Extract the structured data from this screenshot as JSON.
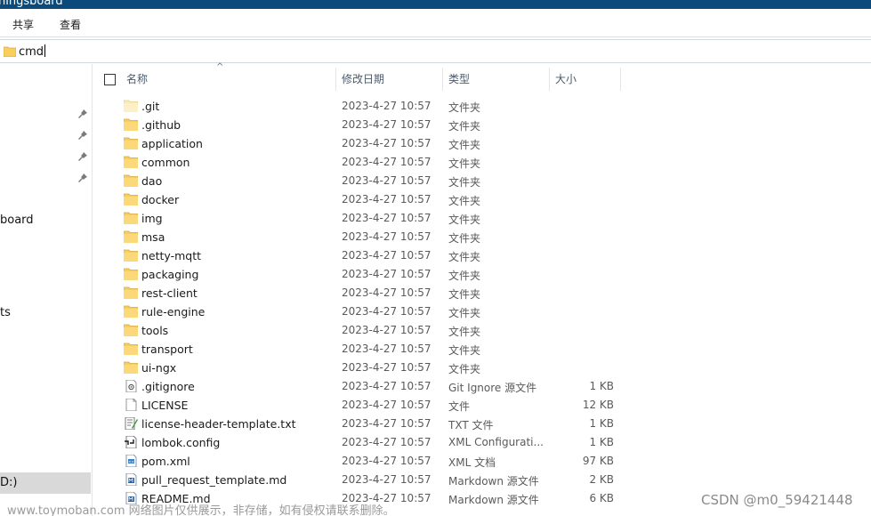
{
  "window": {
    "title": "hingsboard"
  },
  "ribbon": {
    "tabs": [
      "共享",
      "查看"
    ]
  },
  "address": {
    "value": "cmd"
  },
  "nav": {
    "items": [
      "board",
      "ts"
    ],
    "selected": "D:)"
  },
  "columns": {
    "name": "名称",
    "date": "修改日期",
    "type": "类型",
    "size": "大小"
  },
  "files": [
    {
      "name": ".git",
      "date": "2023-4-27 10:57",
      "type": "文件夹",
      "size": "",
      "icon": "folder-light-icon"
    },
    {
      "name": ".github",
      "date": "2023-4-27 10:57",
      "type": "文件夹",
      "size": "",
      "icon": "folder-icon"
    },
    {
      "name": "application",
      "date": "2023-4-27 10:57",
      "type": "文件夹",
      "size": "",
      "icon": "folder-icon"
    },
    {
      "name": "common",
      "date": "2023-4-27 10:57",
      "type": "文件夹",
      "size": "",
      "icon": "folder-icon"
    },
    {
      "name": "dao",
      "date": "2023-4-27 10:57",
      "type": "文件夹",
      "size": "",
      "icon": "folder-icon"
    },
    {
      "name": "docker",
      "date": "2023-4-27 10:57",
      "type": "文件夹",
      "size": "",
      "icon": "folder-icon"
    },
    {
      "name": "img",
      "date": "2023-4-27 10:57",
      "type": "文件夹",
      "size": "",
      "icon": "folder-icon"
    },
    {
      "name": "msa",
      "date": "2023-4-27 10:57",
      "type": "文件夹",
      "size": "",
      "icon": "folder-icon"
    },
    {
      "name": "netty-mqtt",
      "date": "2023-4-27 10:57",
      "type": "文件夹",
      "size": "",
      "icon": "folder-icon"
    },
    {
      "name": "packaging",
      "date": "2023-4-27 10:57",
      "type": "文件夹",
      "size": "",
      "icon": "folder-icon"
    },
    {
      "name": "rest-client",
      "date": "2023-4-27 10:57",
      "type": "文件夹",
      "size": "",
      "icon": "folder-icon"
    },
    {
      "name": "rule-engine",
      "date": "2023-4-27 10:57",
      "type": "文件夹",
      "size": "",
      "icon": "folder-icon"
    },
    {
      "name": "tools",
      "date": "2023-4-27 10:57",
      "type": "文件夹",
      "size": "",
      "icon": "folder-icon"
    },
    {
      "name": "transport",
      "date": "2023-4-27 10:57",
      "type": "文件夹",
      "size": "",
      "icon": "folder-icon"
    },
    {
      "name": "ui-ngx",
      "date": "2023-4-27 10:57",
      "type": "文件夹",
      "size": "",
      "icon": "folder-icon"
    },
    {
      "name": ".gitignore",
      "date": "2023-4-27 10:57",
      "type": "Git Ignore 源文件",
      "size": "1 KB",
      "icon": "config-file-icon"
    },
    {
      "name": "LICENSE",
      "date": "2023-4-27 10:57",
      "type": "文件",
      "size": "12 KB",
      "icon": "blank-file-icon"
    },
    {
      "name": "license-header-template.txt",
      "date": "2023-4-27 10:57",
      "type": "TXT 文件",
      "size": "1 KB",
      "icon": "text-file-icon"
    },
    {
      "name": "lombok.config",
      "date": "2023-4-27 10:57",
      "type": "XML Configurati...",
      "size": "1 KB",
      "icon": "xml-config-icon"
    },
    {
      "name": "pom.xml",
      "date": "2023-4-27 10:57",
      "type": "XML 文档",
      "size": "97 KB",
      "icon": "xml-file-icon"
    },
    {
      "name": "pull_request_template.md",
      "date": "2023-4-27 10:57",
      "type": "Markdown 源文件",
      "size": "2 KB",
      "icon": "markdown-file-icon"
    },
    {
      "name": "README.md",
      "date": "2023-4-27 10:57",
      "type": "Markdown 源文件",
      "size": "6 KB",
      "icon": "markdown-file-icon"
    }
  ],
  "watermark": {
    "left": "www.toymoban.com 网络图片仅供展示，非存储，如有侵权请联系删除。",
    "right": "CSDN @m0_59421448"
  },
  "colors": {
    "titlebar": "#0b4a7a",
    "folder": "#f8cf5e",
    "nav_selected": "#d9d9d9"
  }
}
